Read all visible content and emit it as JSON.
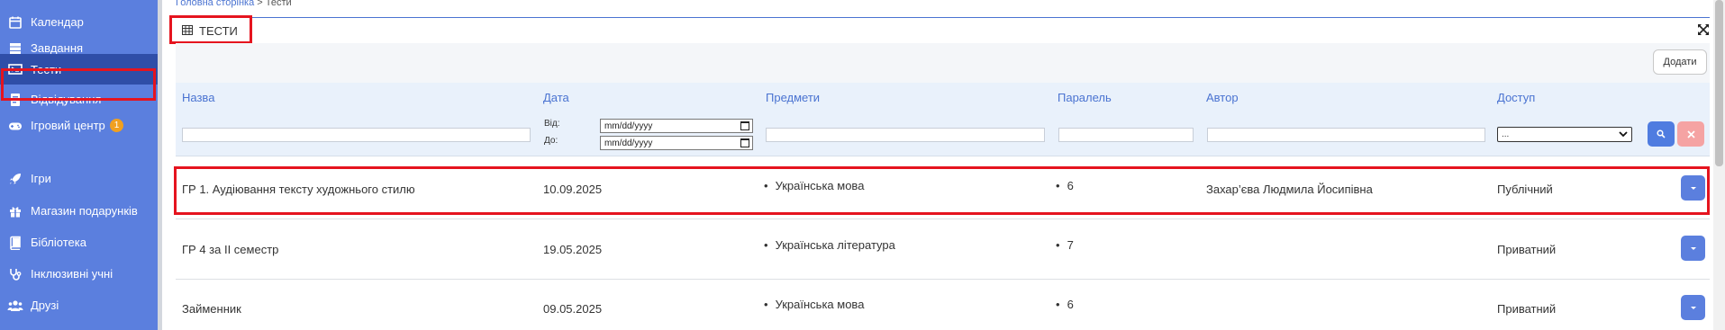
{
  "sidebar": {
    "items": [
      {
        "label": "Календар",
        "icon": "calendar-icon"
      },
      {
        "label": "Завдання",
        "icon": "tasks-icon"
      },
      {
        "label": "Тести",
        "icon": "tests-icon",
        "active": true
      },
      {
        "label": "Відвідування",
        "icon": "attendance-icon"
      },
      {
        "label": "Ігровий центр",
        "icon": "gamepad-icon",
        "badge": "1"
      },
      {
        "label": "Ігри",
        "icon": "rocket-icon"
      },
      {
        "label": "Магазин подарунків",
        "icon": "gift-icon"
      },
      {
        "label": "Бібліотека",
        "icon": "book-icon"
      },
      {
        "label": "Інклюзивні учні",
        "icon": "stethoscope-icon"
      },
      {
        "label": "Друзі",
        "icon": "users-icon"
      }
    ]
  },
  "breadcrumb": {
    "home": "Головна сторінка",
    "separator": " > ",
    "current": "Тести"
  },
  "panel": {
    "title": "ТЕСТИ",
    "add_button": "Додати"
  },
  "table": {
    "headers": {
      "name": "Назва",
      "date": "Дата",
      "subjects": "Предмети",
      "parallel": "Паралель",
      "author": "Автор",
      "access": "Доступ"
    },
    "filters": {
      "date_from_label": "Від:",
      "date_to_label": "До:",
      "date_placeholder": "mm/dd/yyyy",
      "access_selected": "..."
    },
    "rows": [
      {
        "name": "ГР 1. Аудіювання тексту художнього стилю",
        "date": "10.09.2025",
        "subject": "Українська мова",
        "parallel": "6",
        "author": "Захар’єва Людмила Йосипівна",
        "access": "Публічний"
      },
      {
        "name": "ГР 4 за ІІ семестр",
        "date": "19.05.2025",
        "subject": "Українська література",
        "parallel": "7",
        "author": "",
        "access": "Приватний"
      },
      {
        "name": "Займенник",
        "date": "09.05.2025",
        "subject": "Українська мова",
        "parallel": "6",
        "author": "",
        "access": "Приватний"
      }
    ]
  },
  "colors": {
    "sidebar": "#5b7fde",
    "sidebar_active": "#2f4ea8",
    "accent": "#4a73d1",
    "highlight": "#e5141f"
  }
}
